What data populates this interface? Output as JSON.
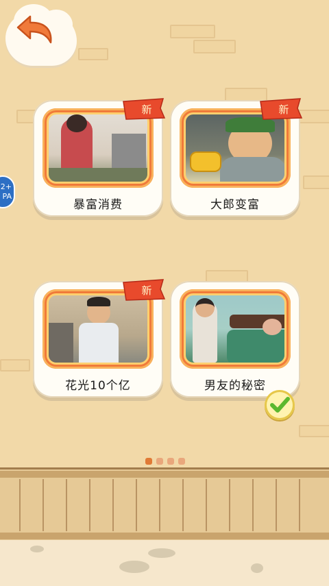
{
  "header": {
    "back_label": ""
  },
  "side_badge": {
    "text": "2+\nPA"
  },
  "levels": [
    {
      "title": "暴富消费",
      "new_label": "新",
      "is_new": true,
      "completed": false
    },
    {
      "title": "大郎变富",
      "new_label": "新",
      "is_new": true,
      "completed": false
    },
    {
      "title": "花光10个亿",
      "new_label": "新",
      "is_new": true,
      "completed": false
    },
    {
      "title": "男友的秘密",
      "new_label": "",
      "is_new": false,
      "completed": true
    }
  ],
  "pagination": {
    "pages": 4,
    "current": 1
  },
  "colors": {
    "background": "#f2d9a8",
    "card_frame": "#f07a3a",
    "ribbon": "#e84a2c",
    "back_arrow": "#f07a3a",
    "check": "#5bb82e"
  },
  "icons": {
    "back": "back-arrow-icon",
    "new": "new-ribbon-icon",
    "completed": "checkmark-icon"
  }
}
